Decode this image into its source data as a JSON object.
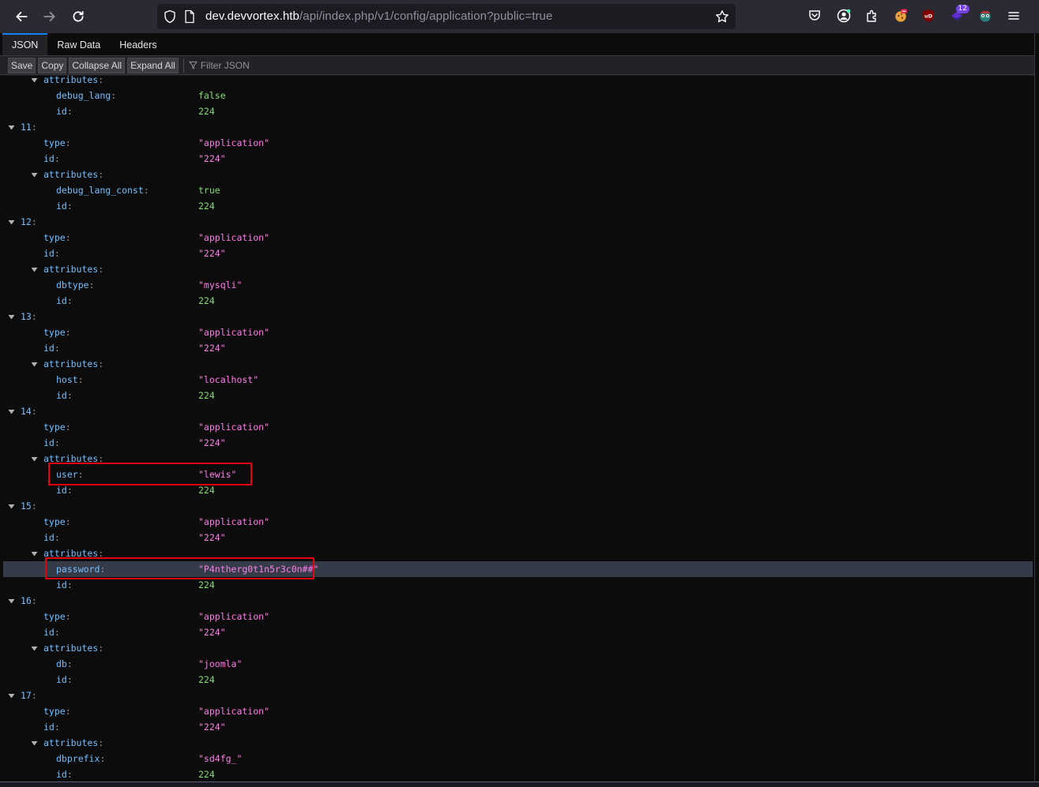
{
  "browser": {
    "url_host": "dev.devvortex.htb",
    "url_path": "/api/index.php/v1/config/application?public=true",
    "extension_badge": "12",
    "colors": {
      "toolbar_bg": "#2b2a33",
      "urlbar_bg": "#1c1b22",
      "accent": "#0a84ff"
    }
  },
  "viewer": {
    "tabs": [
      {
        "label": "JSON"
      },
      {
        "label": "Raw Data"
      },
      {
        "label": "Headers"
      }
    ],
    "toolbar": {
      "save": "Save",
      "copy": "Copy",
      "collapse_all": "Collapse All",
      "expand_all": "Expand All",
      "filter_placeholder": "Filter JSON"
    }
  },
  "json_rows": [
    {
      "indent": 2,
      "key": "attributes",
      "value": "",
      "type": "obj"
    },
    {
      "indent": 3,
      "key": "debug_lang",
      "value": "false",
      "type": "bool"
    },
    {
      "indent": 3,
      "key": "id",
      "value": "224",
      "type": "num"
    },
    {
      "indent": 1,
      "key": "11",
      "value": "",
      "type": "obj"
    },
    {
      "indent": 2,
      "key": "type",
      "value": "\"application\"",
      "type": "str"
    },
    {
      "indent": 2,
      "key": "id",
      "value": "\"224\"",
      "type": "str"
    },
    {
      "indent": 2,
      "key": "attributes",
      "value": "",
      "type": "obj"
    },
    {
      "indent": 3,
      "key": "debug_lang_const",
      "value": "true",
      "type": "bool"
    },
    {
      "indent": 3,
      "key": "id",
      "value": "224",
      "type": "num"
    },
    {
      "indent": 1,
      "key": "12",
      "value": "",
      "type": "obj"
    },
    {
      "indent": 2,
      "key": "type",
      "value": "\"application\"",
      "type": "str"
    },
    {
      "indent": 2,
      "key": "id",
      "value": "\"224\"",
      "type": "str"
    },
    {
      "indent": 2,
      "key": "attributes",
      "value": "",
      "type": "obj"
    },
    {
      "indent": 3,
      "key": "dbtype",
      "value": "\"mysqli\"",
      "type": "str"
    },
    {
      "indent": 3,
      "key": "id",
      "value": "224",
      "type": "num"
    },
    {
      "indent": 1,
      "key": "13",
      "value": "",
      "type": "obj"
    },
    {
      "indent": 2,
      "key": "type",
      "value": "\"application\"",
      "type": "str"
    },
    {
      "indent": 2,
      "key": "id",
      "value": "\"224\"",
      "type": "str"
    },
    {
      "indent": 2,
      "key": "attributes",
      "value": "",
      "type": "obj"
    },
    {
      "indent": 3,
      "key": "host",
      "value": "\"localhost\"",
      "type": "str"
    },
    {
      "indent": 3,
      "key": "id",
      "value": "224",
      "type": "num"
    },
    {
      "indent": 1,
      "key": "14",
      "value": "",
      "type": "obj"
    },
    {
      "indent": 2,
      "key": "type",
      "value": "\"application\"",
      "type": "str"
    },
    {
      "indent": 2,
      "key": "id",
      "value": "\"224\"",
      "type": "str"
    },
    {
      "indent": 2,
      "key": "attributes",
      "value": "",
      "type": "obj"
    },
    {
      "indent": 3,
      "key": "user",
      "value": "\"lewis\"",
      "type": "str"
    },
    {
      "indent": 3,
      "key": "id",
      "value": "224",
      "type": "num"
    },
    {
      "indent": 1,
      "key": "15",
      "value": "",
      "type": "obj"
    },
    {
      "indent": 2,
      "key": "type",
      "value": "\"application\"",
      "type": "str"
    },
    {
      "indent": 2,
      "key": "id",
      "value": "\"224\"",
      "type": "str"
    },
    {
      "indent": 2,
      "key": "attributes",
      "value": "",
      "type": "obj"
    },
    {
      "indent": 3,
      "key": "password",
      "value": "\"P4ntherg0t1n5r3c0n##\"",
      "type": "str",
      "selected": true
    },
    {
      "indent": 3,
      "key": "id",
      "value": "224",
      "type": "num"
    },
    {
      "indent": 1,
      "key": "16",
      "value": "",
      "type": "obj"
    },
    {
      "indent": 2,
      "key": "type",
      "value": "\"application\"",
      "type": "str"
    },
    {
      "indent": 2,
      "key": "id",
      "value": "\"224\"",
      "type": "str"
    },
    {
      "indent": 2,
      "key": "attributes",
      "value": "",
      "type": "obj"
    },
    {
      "indent": 3,
      "key": "db",
      "value": "\"joomla\"",
      "type": "str"
    },
    {
      "indent": 3,
      "key": "id",
      "value": "224",
      "type": "num"
    },
    {
      "indent": 1,
      "key": "17",
      "value": "",
      "type": "obj"
    },
    {
      "indent": 2,
      "key": "type",
      "value": "\"application\"",
      "type": "str"
    },
    {
      "indent": 2,
      "key": "id",
      "value": "\"224\"",
      "type": "str"
    },
    {
      "indent": 2,
      "key": "attributes",
      "value": "",
      "type": "obj"
    },
    {
      "indent": 3,
      "key": "dbprefix",
      "value": "\"sd4fg_\"",
      "type": "str"
    },
    {
      "indent": 3,
      "key": "id",
      "value": "224",
      "type": "num"
    }
  ]
}
